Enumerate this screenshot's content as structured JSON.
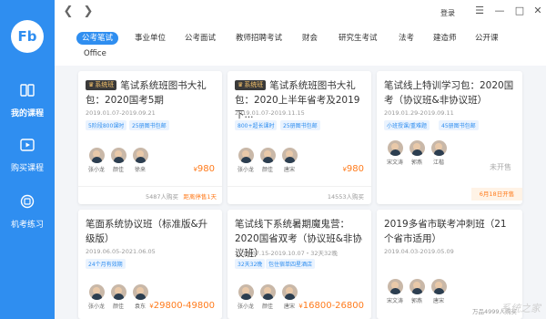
{
  "app": {
    "logo_text": "Fb",
    "accent": "#2f8ef0",
    "price_color": "#ff7b1c"
  },
  "sidebar": {
    "items": [
      {
        "label": "我的课程",
        "icon": "book-icon"
      },
      {
        "label": "购买课程",
        "icon": "play-icon"
      },
      {
        "label": "机考练习",
        "icon": "exam-icon"
      }
    ]
  },
  "topbar": {
    "login_label": "登录",
    "back_icon": "chevron-left-icon",
    "forward_icon": "chevron-right-icon"
  },
  "tabs": [
    "公考笔试",
    "事业单位",
    "公考面试",
    "教师招聘考试",
    "财会",
    "研究生考试",
    "法考",
    "建造师",
    "公开课",
    "Office"
  ],
  "active_tab": 0,
  "cards": [
    {
      "tag": "系统班",
      "title": "笔试系统班图书大礼包：2020国考5期",
      "date": "2019.01.07-2019.09.21",
      "chips": [
        "5阶段800课时",
        "25册图书包邮"
      ],
      "teachers": [
        "张小龙",
        "颜佳",
        "徐来"
      ],
      "price": "980",
      "buyers": "5487人购买",
      "remain": "距离停售1天"
    },
    {
      "tag": "系统班",
      "title": "笔试系统班图书大礼包：2020上半年省考及2019下...",
      "date": "2019.01.07-2019.11.15",
      "chips": [
        "800+超长课时",
        "25册图书包邮"
      ],
      "teachers": [
        "张小龙",
        "颜佳",
        "唐宋"
      ],
      "price": "980",
      "buyers": "14553人购买",
      "remain": ""
    },
    {
      "tag": "",
      "title": "笔试线上特训学习包：2020国考（协议班&非协议班）",
      "date": "2019.01.29-2019.09.11",
      "chips": [
        "小班授课/重难题",
        "45册图书包邮"
      ],
      "teachers": [
        "宋文涛",
        "郭燕",
        "江楷"
      ],
      "status": "未开售",
      "start": "6月18日开售"
    },
    {
      "tag": "",
      "title": "笔面系统协议班（标准版&升级版）",
      "date": "2019.06.05-2021.06.05",
      "chips": [
        "24个月有效期"
      ],
      "teachers": [
        "张小龙",
        "颜佳",
        "袁东"
      ],
      "price": "29800-49800"
    },
    {
      "tag": "",
      "title": "笔试线下系统暑期魔鬼营：2020国省双考（协议班&非协议班）",
      "date": "2019.07.15-2019.10.07・32天32晚",
      "chips": [
        "32天32晚",
        "包住宿单四星酒店"
      ],
      "teachers": [
        "张小龙",
        "颜佳",
        "唐宋"
      ],
      "price": "16800-26800"
    },
    {
      "tag": "",
      "title": "2019多省市联考冲刺班（21个省市适用）",
      "date": "2019.04.03-2019.05.09",
      "chips": [],
      "teachers": [
        "宋文涛",
        "郭燕",
        "唐宋"
      ],
      "buyers": "万品4999人购买"
    }
  ],
  "watermark": "系统之家"
}
